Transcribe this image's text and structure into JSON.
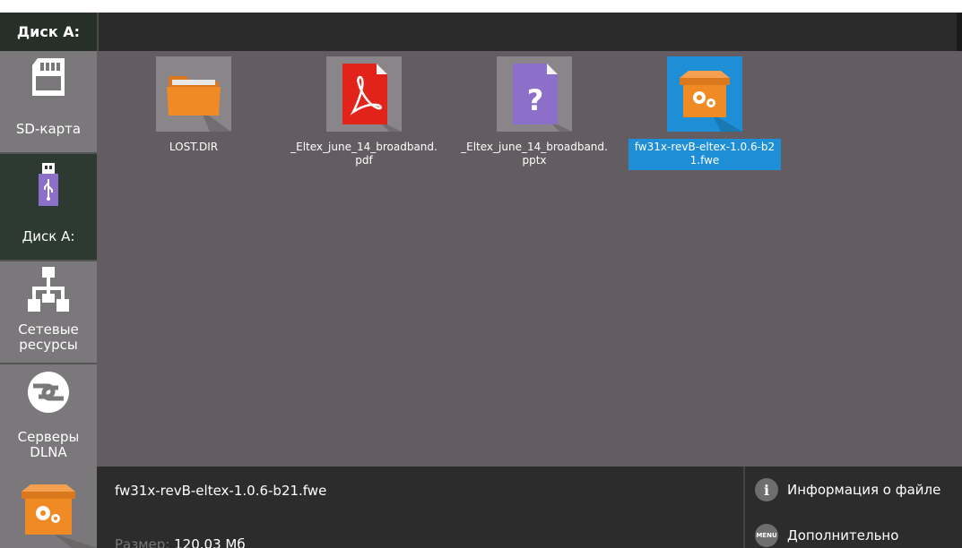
{
  "header": {
    "title": "Диск А:"
  },
  "sidebar": {
    "items": [
      {
        "label": "SD-карта",
        "icon": "sd-card-icon"
      },
      {
        "label": "Диск А:",
        "icon": "usb-drive-icon",
        "active": true
      },
      {
        "label": "Сетевые ресурсы",
        "icon": "network-icon"
      },
      {
        "label": "Серверы DLNA",
        "icon": "dlna-icon"
      }
    ]
  },
  "files": [
    {
      "name": "LOST.DIR",
      "icon": "folder-icon"
    },
    {
      "name": "_Eltex_june_14_broadband.pdf",
      "icon": "pdf-icon"
    },
    {
      "name": "_Eltex_june_14_broadband.pptx",
      "icon": "unknown-file-icon"
    },
    {
      "name": "fw31x-revB-eltex-1.0.6-b21.fwe",
      "icon": "package-icon",
      "selected": true
    }
  ],
  "details": {
    "name": "fw31x-revB-eltex-1.0.6-b21.fwe",
    "size_label": "Размер:",
    "size_value": "120.03 Мб"
  },
  "actions": {
    "info_label": "Информация о файле",
    "info_icon_text": "i",
    "more_label": "Дополнительно",
    "more_icon_text": "MENU"
  },
  "colors": {
    "background": "#635d62",
    "sidebar": "#7b787b",
    "sidebar_active": "#2c3a32",
    "selection": "#1e8fd6",
    "folder": "#f08a24",
    "pdf": "#e2231a",
    "unknown": "#8b6fc8"
  }
}
